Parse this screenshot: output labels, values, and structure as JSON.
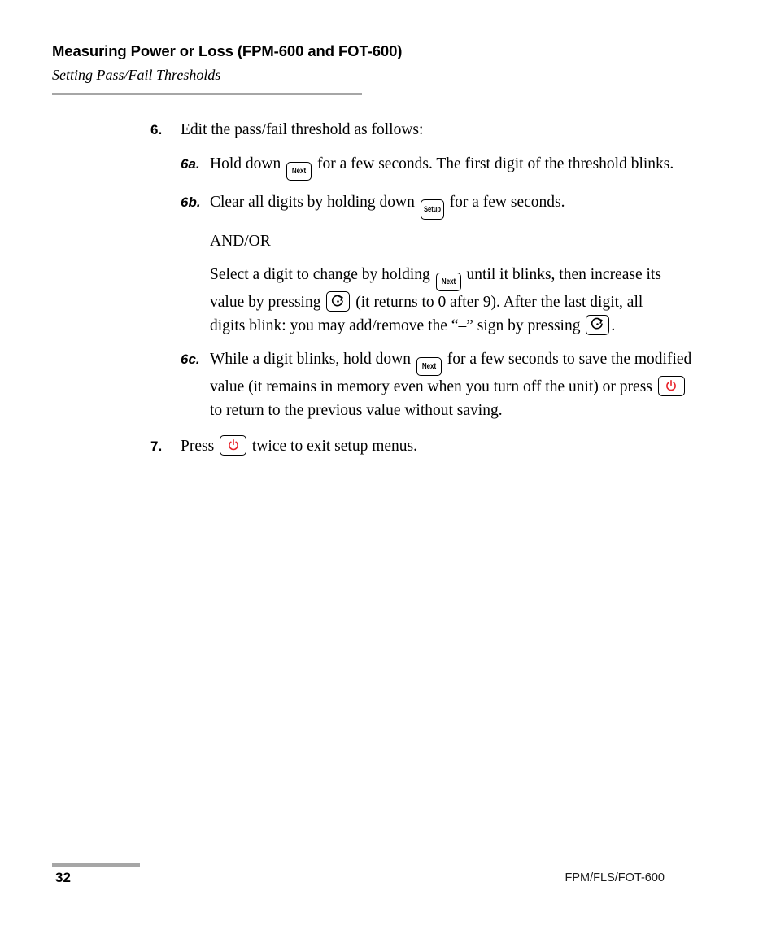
{
  "header": {
    "title": "Measuring Power or Loss (FPM-600 and FOT-600)",
    "subtitle": "Setting Pass/Fail Thresholds"
  },
  "steps": {
    "step6": {
      "marker": "6.",
      "text": "Edit the pass/fail threshold as follows:"
    },
    "step6a": {
      "marker": "6a.",
      "text_before": "Hold down",
      "key": "Next",
      "text_after": "for a few seconds. The first digit of the threshold blinks."
    },
    "step6b": {
      "marker": "6b.",
      "text_before": "Clear all digits by holding down",
      "key": "Setup",
      "text_after": "for a few seconds."
    },
    "andor": {
      "text": "AND/OR"
    },
    "select_digit": {
      "part1": "Select a digit to change by holding",
      "key1": "Next",
      "part2": "until it blinks, then increase its value by pressing",
      "key2": "rotate-icon",
      "part3": "(it returns to 0 after 9). After the last digit, all digits blink: you may add/remove the “–” sign by pressing",
      "key3": "rotate-icon",
      "part4": "."
    },
    "step6c": {
      "marker": "6c.",
      "part1": "While a digit blinks, hold down",
      "key1": "Next",
      "part2": "for a few seconds to save the modified value (it remains in memory even when you turn off the unit) or press",
      "key2": "power-icon",
      "part3": "to return to the previous value without saving."
    },
    "step7": {
      "marker": "7.",
      "part1": "Press",
      "key1": "power-icon",
      "part2": "twice to exit setup menus."
    }
  },
  "footer": {
    "page_number": "32",
    "product": "FPM/FLS/FOT-600"
  },
  "colors": {
    "power_icon": "#e8232a",
    "rule_gray": "#a6a6a6",
    "text": "#000000"
  }
}
